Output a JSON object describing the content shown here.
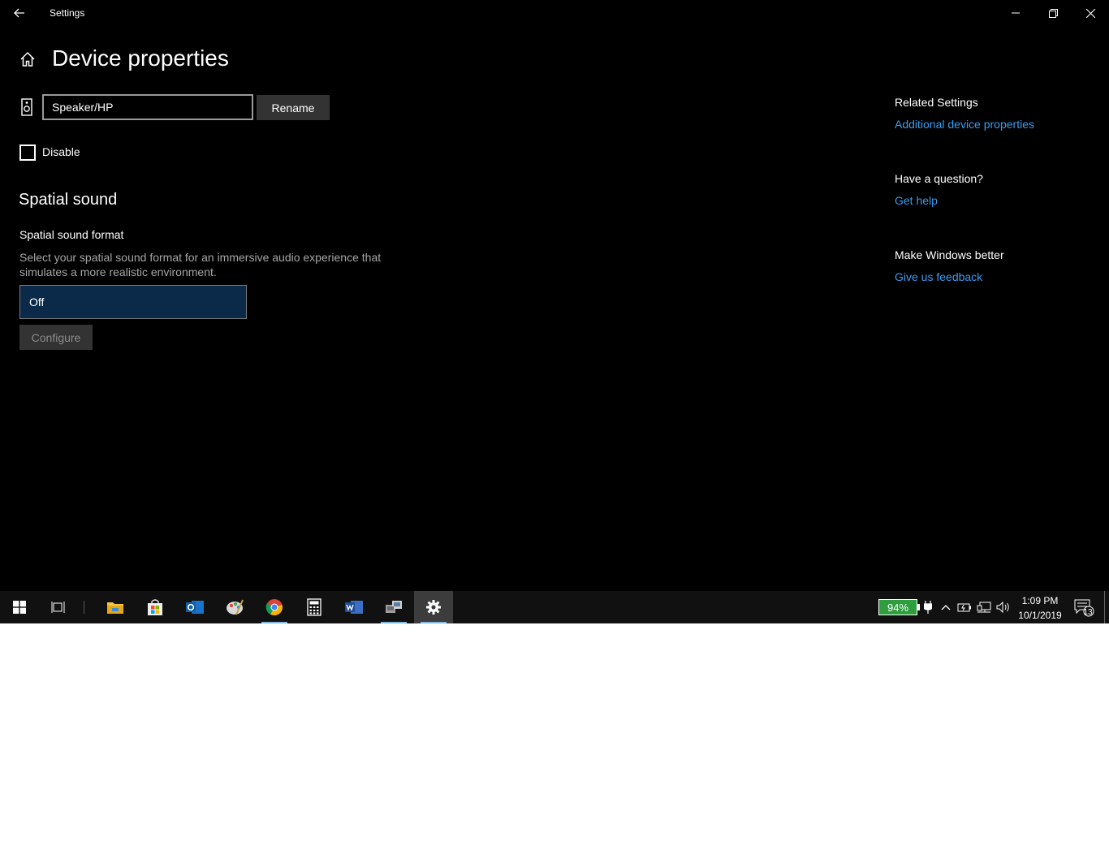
{
  "window": {
    "title": "Settings",
    "back_icon": "back-arrow-icon",
    "minimize_icon": "minimize-icon",
    "restore_icon": "restore-icon",
    "close_icon": "close-icon"
  },
  "page": {
    "home_icon": "home-icon",
    "title": "Device properties"
  },
  "device": {
    "icon": "speaker-icon",
    "name_value": "Speaker/HP",
    "rename_label": "Rename",
    "disable_label": "Disable",
    "disable_checked": false
  },
  "spatial": {
    "section_title": "Spatial sound",
    "format_label": "Spatial sound format",
    "description": "Select your spatial sound format for an immersive audio experience that simulates a more realistic environment.",
    "selected_format": "Off",
    "configure_label": "Configure",
    "configure_enabled": false
  },
  "sidebar": {
    "related_heading": "Related Settings",
    "related_link": "Additional device properties",
    "question_heading": "Have a question?",
    "question_link": "Get help",
    "feedback_heading": "Make Windows better",
    "feedback_link": "Give us feedback"
  },
  "taskbar": {
    "apps": [
      {
        "name": "start",
        "icon": "windows-logo-icon"
      },
      {
        "name": "task-view",
        "icon": "task-view-icon"
      },
      {
        "name": "file-explorer",
        "icon": "folder-icon"
      },
      {
        "name": "store",
        "icon": "store-bag-icon"
      },
      {
        "name": "outlook",
        "icon": "outlook-icon"
      },
      {
        "name": "paint",
        "icon": "paint-palette-icon"
      },
      {
        "name": "chrome",
        "icon": "chrome-icon"
      },
      {
        "name": "calculator",
        "icon": "calculator-icon"
      },
      {
        "name": "word",
        "icon": "word-icon"
      },
      {
        "name": "network-app",
        "icon": "network-computers-icon"
      },
      {
        "name": "settings",
        "icon": "gear-icon",
        "active": true
      }
    ],
    "battery_percent": "94%",
    "time": "1:09 PM",
    "date": "10/1/2019",
    "notification_count": "13"
  },
  "colors": {
    "accent_link": "#3a9bf0",
    "dropdown_bg": "#0b2a4a",
    "battery_green": "#2e9e3e"
  }
}
